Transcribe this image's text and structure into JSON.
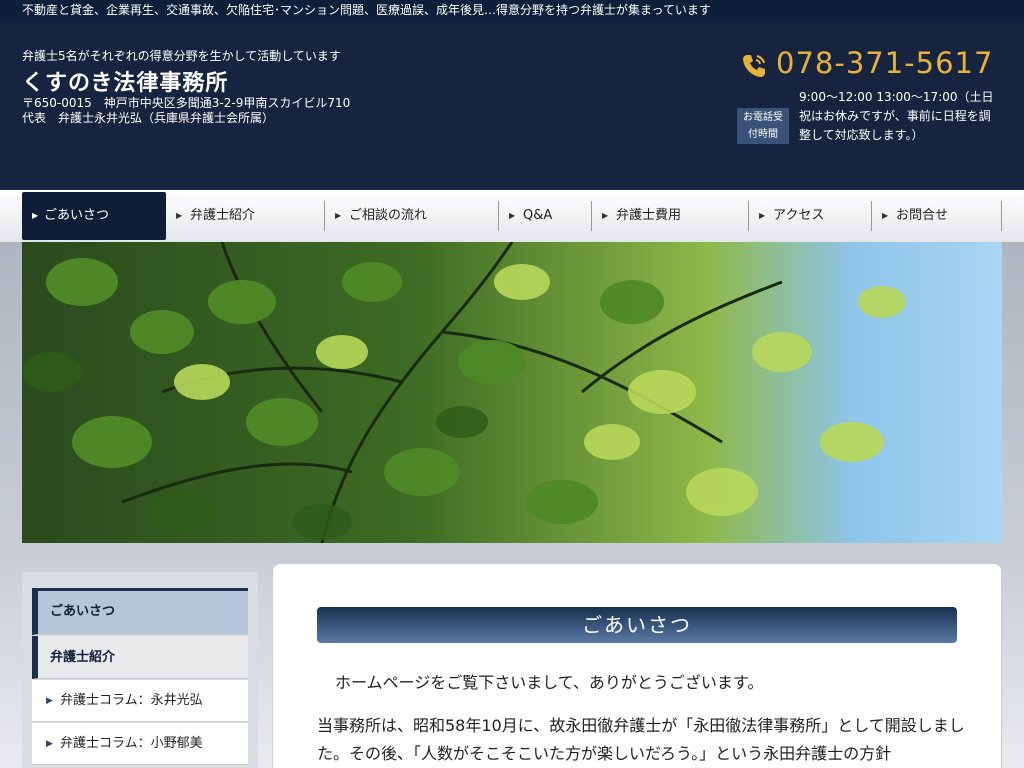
{
  "topbar": {
    "text": "不動産と貸金、企業再生、交通事故、欠陥住宅･マンション問題、医療過誤、成年後見…得意分野を持つ弁護士が集まっています"
  },
  "header": {
    "tagline": "弁護士5名がそれぞれの得意分野を生かして活動しています",
    "firm_name": "くすのき法律事務所",
    "address_line1": "〒650-0015　神戸市中央区多聞通3-2-9甲南スカイビル710",
    "address_line2": "代表　弁護士永井光弘（兵庫県弁護士会所属）",
    "phone": "078-371-5617",
    "hours_badge_line1": "お電話受",
    "hours_badge_line2": "付時間",
    "hours": "9:00〜12:00 13:00〜17:00（土日祝はお休みですが、事前に日程を調整して対応致します。）",
    "phone_icon": "phone-icon"
  },
  "nav": {
    "items": [
      {
        "label": "ごあいさつ",
        "active": true
      },
      {
        "label": "弁護士紹介"
      },
      {
        "label": "ご相談の流れ"
      },
      {
        "label": "Q&A"
      },
      {
        "label": "弁護士費用"
      },
      {
        "label": "アクセス"
      },
      {
        "label": "お問合せ"
      }
    ]
  },
  "sidebar": {
    "items": [
      {
        "label": "ごあいさつ"
      },
      {
        "label": "弁護士紹介"
      },
      {
        "label": "弁護士コラム：永井光弘"
      },
      {
        "label": "弁護士コラム：小野郁美"
      }
    ]
  },
  "content": {
    "title": "ごあいさつ",
    "para1": "ホームページをご覧下さいまして、ありがとうございます。",
    "para2": "当事務所は、昭和58年10月に、故永田徹弁護士が「永田徹法律事務所」として開設しました。その後、「人数がそこそこいた方が楽しいだろう。」という永田弁護士の方針"
  },
  "colors": {
    "header_bg": "#16243f",
    "accent_phone": "#e8b23a",
    "nav_active": "#0f1d36"
  }
}
